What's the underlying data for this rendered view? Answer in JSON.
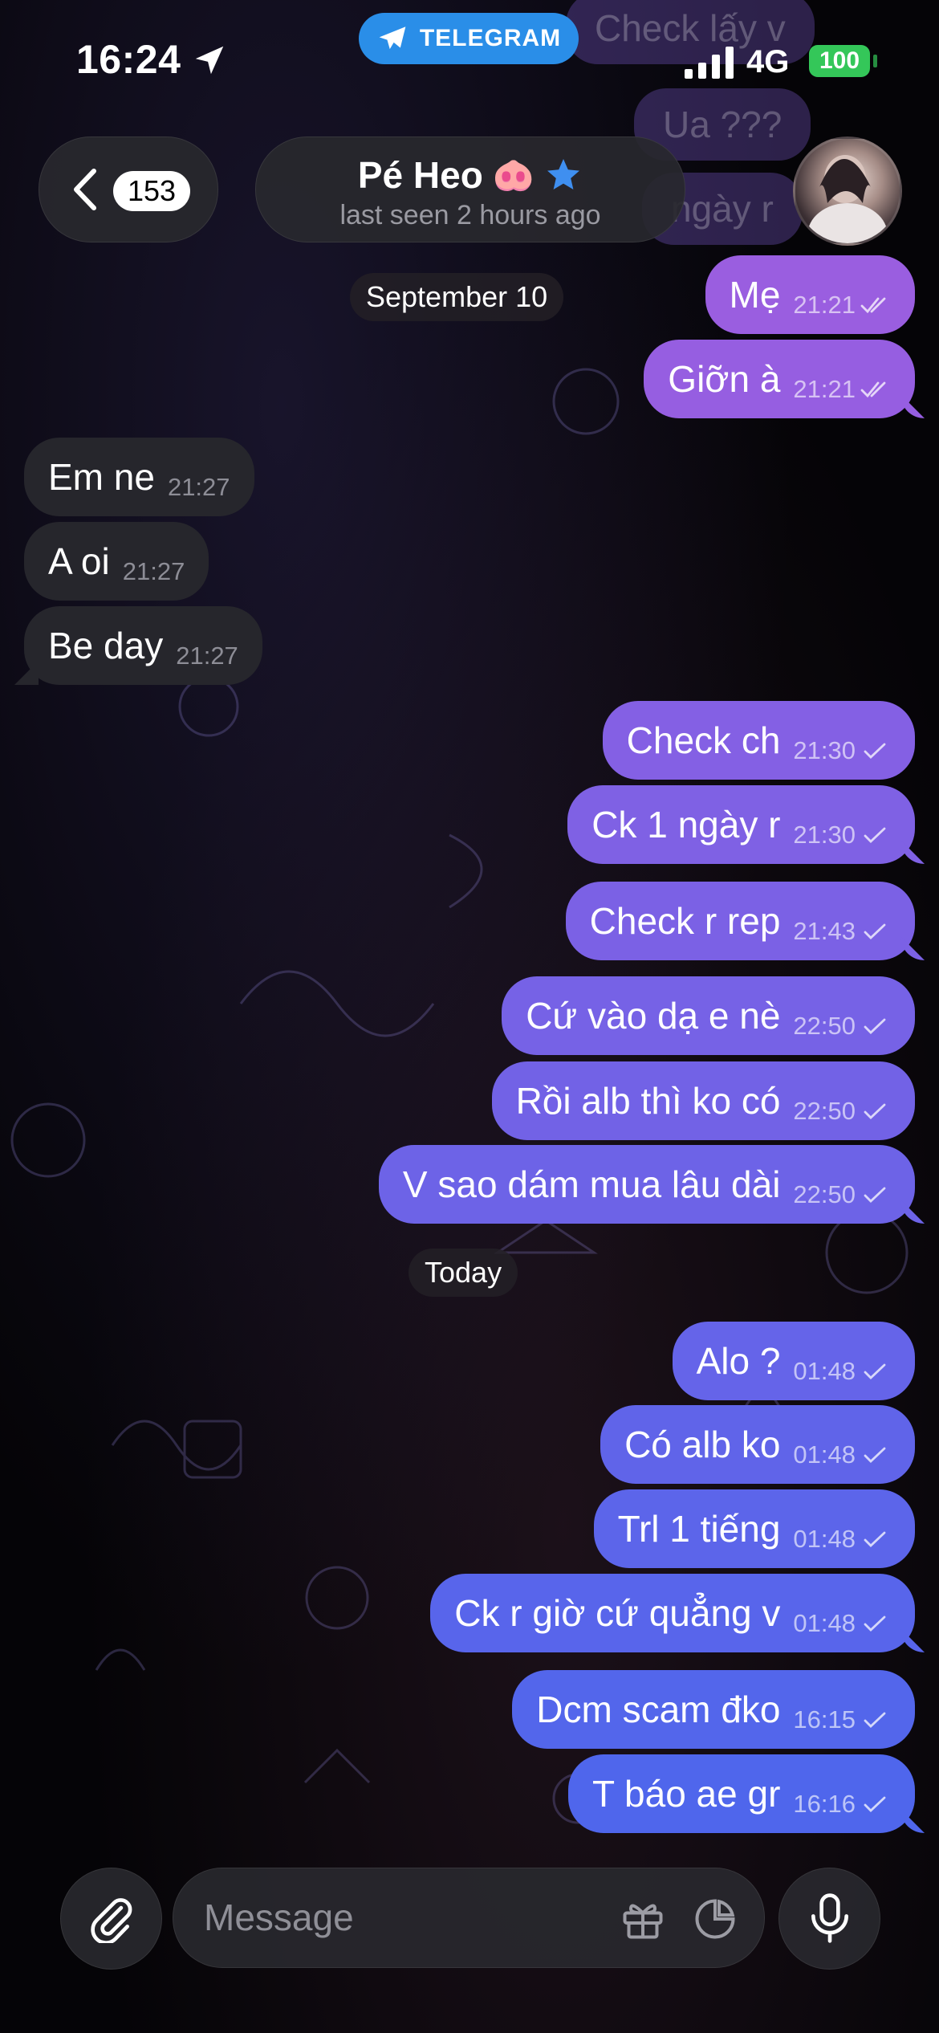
{
  "status_bar": {
    "time": "16:24",
    "network": "4G",
    "battery": "100",
    "app_pill": "TELEGRAM"
  },
  "header": {
    "back_count": "153",
    "name": "Pé Heo",
    "name_emoji": "🐽",
    "status": "last seen 2 hours ago",
    "ghost_texts": [
      "Check lấy v",
      "Ua ???",
      "ngày r"
    ]
  },
  "date_separators": [
    "September 10",
    "Today"
  ],
  "messages": [
    {
      "dir": "out",
      "text": "Mẹ",
      "time": "21:21",
      "read": "double"
    },
    {
      "dir": "out",
      "text": "Giỡn à",
      "time": "21:21",
      "read": "double"
    },
    {
      "dir": "in",
      "text": "Em ne",
      "time": "21:27"
    },
    {
      "dir": "in",
      "text": "A oi",
      "time": "21:27"
    },
    {
      "dir": "in",
      "text": "Be day",
      "time": "21:27"
    },
    {
      "dir": "out",
      "text": "Check ch",
      "time": "21:30",
      "read": "single"
    },
    {
      "dir": "out",
      "text": "Ck 1 ngày r",
      "time": "21:30",
      "read": "single"
    },
    {
      "dir": "out",
      "text": "Check r rep",
      "time": "21:43",
      "read": "single"
    },
    {
      "dir": "out",
      "text": "Cứ vào dạ e nè",
      "time": "22:50",
      "read": "single"
    },
    {
      "dir": "out",
      "text": "Rồi alb thì ko có",
      "time": "22:50",
      "read": "single"
    },
    {
      "dir": "out",
      "text": "V sao dám mua lâu dài",
      "time": "22:50",
      "read": "single"
    },
    {
      "dir": "out",
      "text": "Alo ?",
      "time": "01:48",
      "read": "single"
    },
    {
      "dir": "out",
      "text": "Có alb ko",
      "time": "01:48",
      "read": "single"
    },
    {
      "dir": "out",
      "text": "Trl 1 tiếng",
      "time": "01:48",
      "read": "single"
    },
    {
      "dir": "out",
      "text": "Ck r giờ cứ quẳng v",
      "time": "01:48",
      "read": "single"
    },
    {
      "dir": "out",
      "text": "Dcm scam đko",
      "time": "16:15",
      "read": "single"
    },
    {
      "dir": "out",
      "text": "T báo ae gr",
      "time": "16:16",
      "read": "single"
    }
  ],
  "composer": {
    "placeholder": "Message"
  },
  "icons": [
    "location-arrow-icon",
    "telegram-plane-icon",
    "signal-icon",
    "chevron-left-icon",
    "verified-star-icon",
    "attach-paperclip-icon",
    "gift-icon",
    "sticker-icon",
    "microphone-icon"
  ],
  "colors": {
    "bubble_out_top": "#9a5ee0",
    "bubble_out_bottom": "#4f66ec",
    "bubble_in": "#26262c",
    "telegram_blue": "#2a8ee8",
    "battery_green": "#34c759"
  }
}
